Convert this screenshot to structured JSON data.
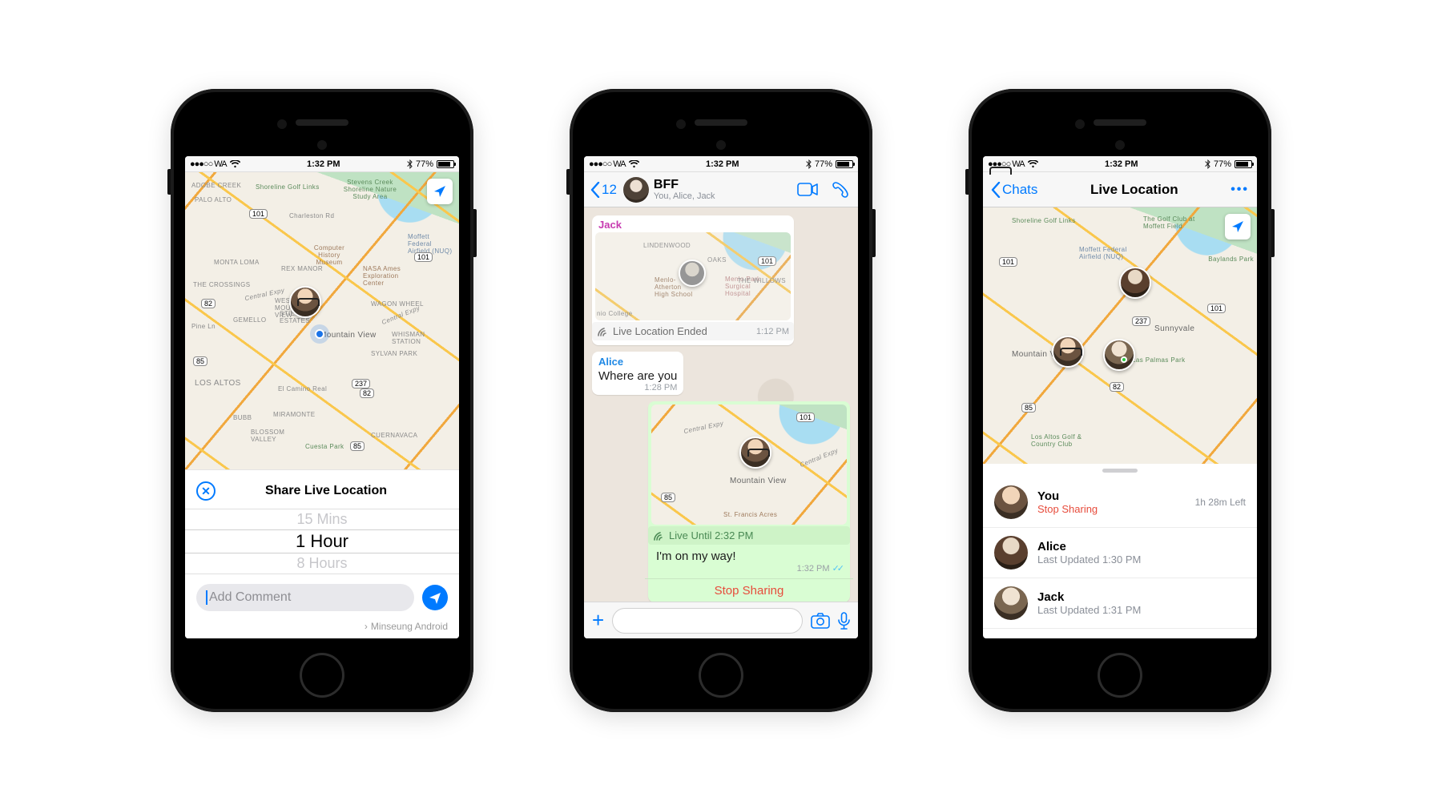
{
  "statusbar": {
    "carrier": "●●●○○ WA",
    "time": "1:32 PM",
    "battery_pct": "77%"
  },
  "screen1": {
    "sheet_title": "Share Live Location",
    "picker": {
      "opt0": "15 Mins",
      "opt1": "1 Hour",
      "opt2": "8 Hours"
    },
    "comment_placeholder": "Add Comment",
    "swipe_label": "Minseung Android",
    "map_labels": {
      "adobe": "ADOBE CREEK",
      "palo": "PALO ALTO",
      "shoreline": "Shoreline Golf Links",
      "stevens": "Stevens Creek Shoreline Nature Study Area",
      "charleston": "Charleston Rd",
      "moffett": "Moffett Federal Airfield (NUQ)",
      "history": "Computer History Museum",
      "monta": "MONTA LOMA",
      "rex": "REX MANOR",
      "nasa": "NASA Ames Exploration Center",
      "crossings": "THE CROSSINGS",
      "centralL": "Central Expy",
      "centralR": "Central Expy",
      "pine": "Pine Ln",
      "gemello": "GEMELLO",
      "stierlin": "STIERLIN ESTATES",
      "westmv": "WEST MOUNTAIN VIEW",
      "mtnview": "Mountain View",
      "wagon": "WAGON WHEEL",
      "sylvan": "SYLVAN PARK",
      "whisman": "WHISMAN STATION",
      "losaltos": "LOS ALTOS",
      "camino": "El Camino Real",
      "bubb": "BUBB",
      "miramonte": "MIRAMONTE",
      "blossom": "BLOSSOM VALLEY",
      "cuesta": "Cuesta Park",
      "cuernavaca": "CUERNAVACA"
    },
    "shields": {
      "s101a": "101",
      "s101b": "101",
      "s82a": "82",
      "s82b": "82",
      "s237": "237",
      "s85a": "85",
      "s85b": "85"
    }
  },
  "screen2": {
    "back_count": "12",
    "group_name": "BFF",
    "group_sub": "You, Alice, Jack",
    "jack_name": "Jack",
    "jack_caption": "Live Location Ended",
    "jack_time": "1:12 PM",
    "alice_name": "Alice",
    "alice_text": "Where are you",
    "alice_time": "1:28 PM",
    "my_caption": "Live Until 2:32 PM",
    "my_text": "I'm on my way!",
    "my_time": "1:32 PM",
    "stop": "Stop Sharing",
    "map_labels": {
      "lindenwood": "LINDENWOOD",
      "oaks": "OAKS",
      "menlo_ath": "Menlo-Atherton High School",
      "surgical": "Menlo Park Surgical Hospital",
      "willows": "THE WILLOWS",
      "cnio": "nio College",
      "centralA": "Central Expy",
      "centralB": "Central Expy",
      "mtnview2": "Mountain View",
      "francis": "St. Francis Acres",
      "s101c": "101",
      "s101d": "101",
      "s85c": "85"
    }
  },
  "screen3": {
    "back_label": "Chats",
    "title": "Live Location",
    "rows": {
      "you": {
        "name": "You",
        "sub": "Stop Sharing",
        "right": "1h 28m Left"
      },
      "alice": {
        "name": "Alice",
        "sub": "Last Updated 1:30 PM"
      },
      "jack": {
        "name": "Jack",
        "sub": "Last Updated 1:31 PM"
      }
    },
    "map_labels": {
      "shoreline3": "Shoreline Golf Links",
      "golfclub": "The Golf Club at Moffett Field",
      "moffett3": "Moffett Federal Airfield (NUQ)",
      "baylands": "Baylands Park",
      "mv3": "Mountain View",
      "sunnyvale": "Sunnyvale",
      "palmas": "Las Palmas Park",
      "laag": "Los Altos Golf & Country Club",
      "s101e": "101",
      "s101f": "101",
      "s237b": "237",
      "s85d": "85",
      "s82c": "82"
    }
  }
}
